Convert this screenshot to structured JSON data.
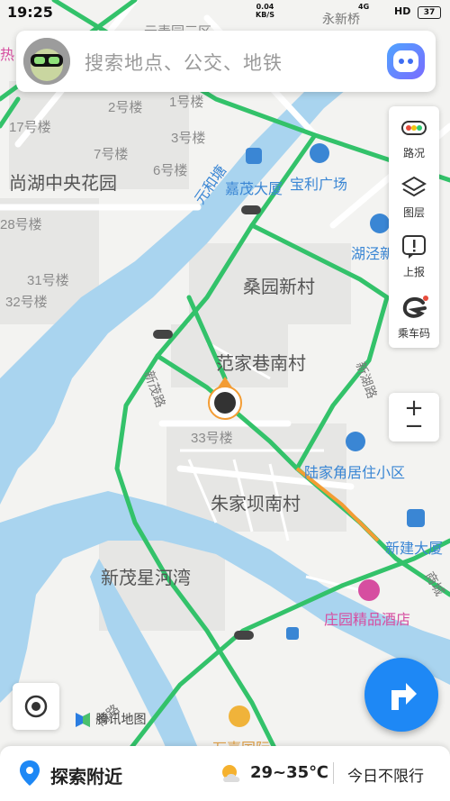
{
  "status_bar": {
    "time": "19:25",
    "speed_value": "0.04",
    "speed_unit": "KB/S",
    "network": "4G",
    "hd": "HD",
    "battery": "37"
  },
  "search": {
    "placeholder": "搜索地点、公交、地铁"
  },
  "tools": [
    {
      "label": "路况"
    },
    {
      "label": "图层"
    },
    {
      "label": "上报"
    },
    {
      "label": "乘车码"
    }
  ],
  "zoom": {
    "plus": "+",
    "minus": "−"
  },
  "map_labels": {
    "top_area": "云麦园三区",
    "top_right": "永新桥",
    "hot": "热",
    "building_2": "2号楼",
    "building_1": "1号楼",
    "building_17": "17号楼",
    "building_7": "7号楼",
    "building_3": "3号楼",
    "building_6": "6号楼",
    "shanghu": "尚湖中央花园",
    "building_28": "28号楼",
    "building_31": "31号楼",
    "building_32": "32号楼",
    "yuanhe": "元和塘",
    "jiamao": "嘉茂大厦",
    "baoli": "宝利广场",
    "hujing": "湖泾新",
    "sangyuan": "桑园新村",
    "fanjia": "范家巷南村",
    "xinmao_road": "新茂路",
    "xinhu_road": "新湖路",
    "building_33": "33号楼",
    "lujiajiao": "陆家角居住小区",
    "zhujiaba": "朱家坝南村",
    "xinjian": "新建大厦",
    "shangcheng": "商城",
    "xinmao_xinghe": "新茂星河湾",
    "zhuangyuan": "庄园精品酒店",
    "nan_road": "南路",
    "partial_bottom": "万嘉国际",
    "tencent_maps": "腾讯地图"
  },
  "bottom_bar": {
    "explore": "探索附近",
    "weather": "29~35℃",
    "limit": "今日不限行"
  },
  "colors": {
    "road_green": "#33c26a",
    "road_orange": "#f39c33",
    "water": "#a9d4ef",
    "accent": "#1e88f5",
    "poi_blue": "#3a86d4",
    "poi_pink": "#d64ea0"
  }
}
